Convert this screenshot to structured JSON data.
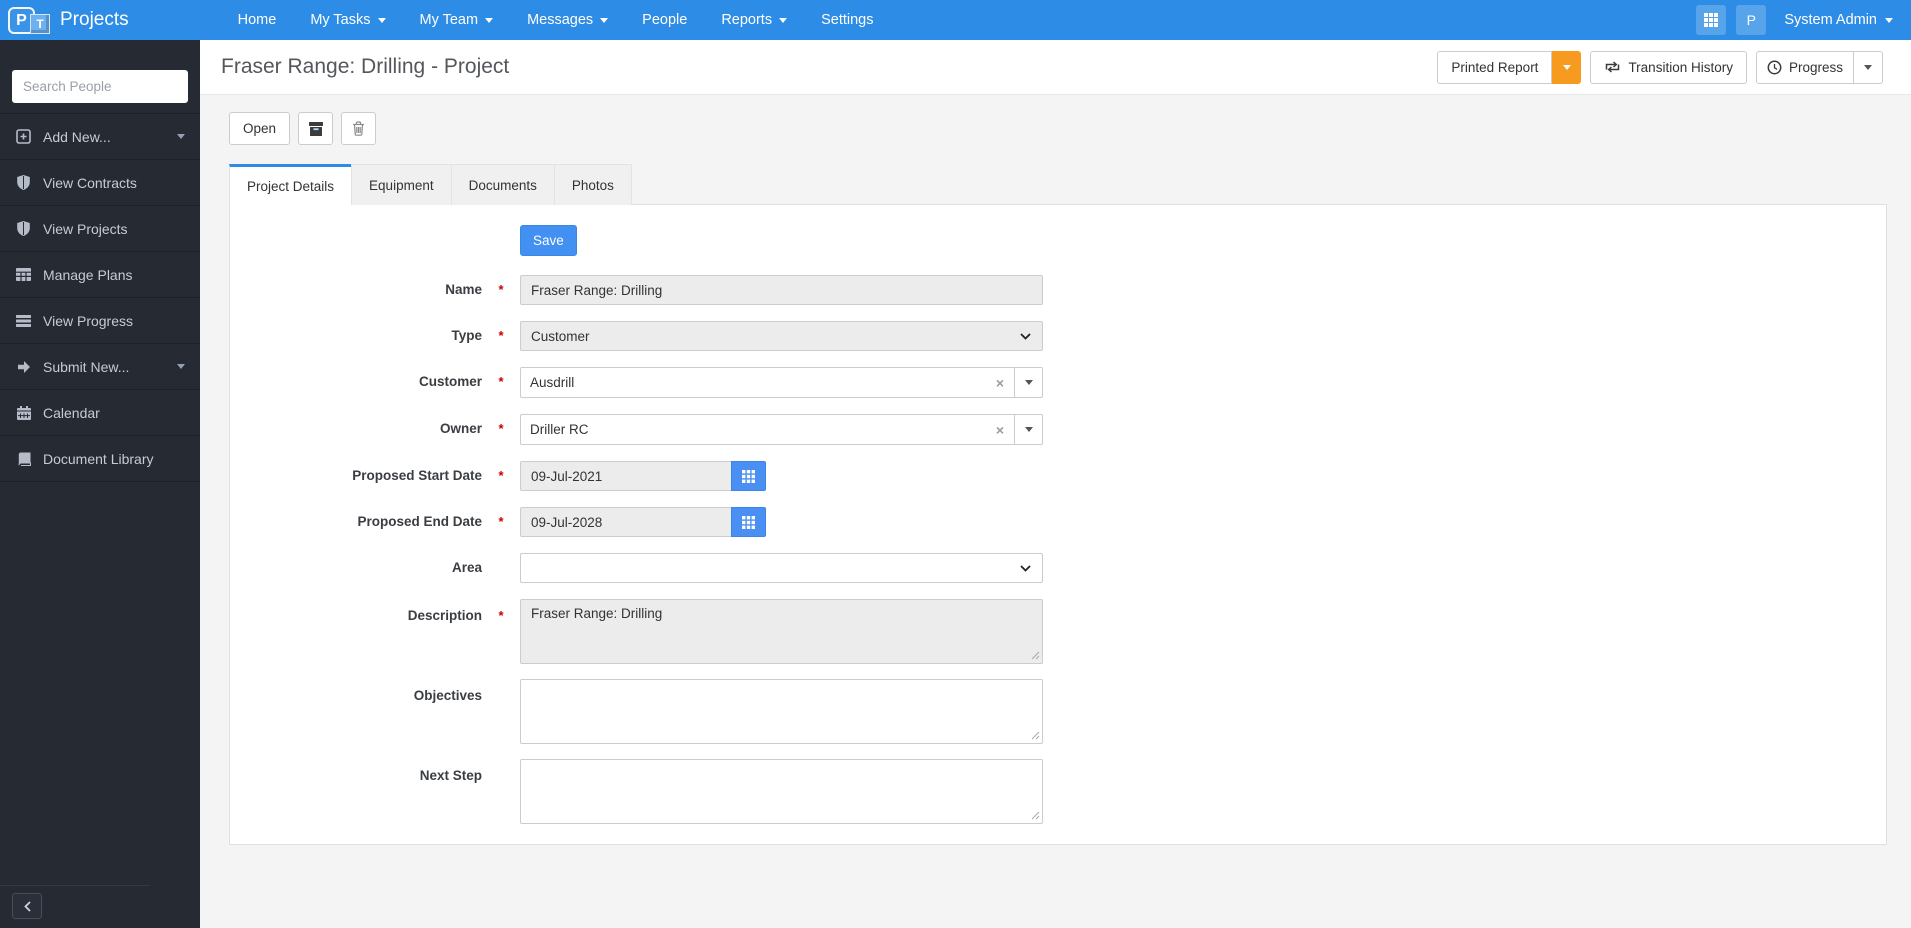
{
  "navbar": {
    "brand": "Projects",
    "logo": {
      "letter_p": "P",
      "letter_t": "T"
    },
    "items": [
      {
        "label": "Home",
        "caret": false
      },
      {
        "label": "My Tasks",
        "caret": true
      },
      {
        "label": "My Team",
        "caret": true
      },
      {
        "label": "Messages",
        "caret": true
      },
      {
        "label": "People",
        "caret": false
      },
      {
        "label": "Reports",
        "caret": true
      },
      {
        "label": "Settings",
        "caret": false
      }
    ],
    "right": {
      "apps_icon": "grid-icon",
      "profile_initial": "P",
      "user": "System Admin"
    }
  },
  "sidebar": {
    "search_placeholder": "Search People",
    "items": [
      {
        "label": "Add New...",
        "icon": "plus-square-icon",
        "caret": true
      },
      {
        "label": "View Contracts",
        "icon": "shield-icon",
        "caret": false
      },
      {
        "label": "View Projects",
        "icon": "shield-icon",
        "caret": false
      },
      {
        "label": "Manage Plans",
        "icon": "table-icon",
        "caret": false
      },
      {
        "label": "View Progress",
        "icon": "progress-bars-icon",
        "caret": false
      },
      {
        "label": "Submit New...",
        "icon": "arrow-right-icon",
        "caret": true
      },
      {
        "label": "Calendar",
        "icon": "calendar-icon",
        "caret": false
      },
      {
        "label": "Document Library",
        "icon": "book-icon",
        "caret": false
      }
    ],
    "collapse_icon": "chevron-left-icon"
  },
  "header": {
    "title": "Fraser Range: Drilling - Project",
    "printed_report_label": "Printed Report",
    "transition_history_label": "Transition History",
    "transition_history_icon": "retweet-icon",
    "progress_label": "Progress",
    "progress_icon": "clock-icon"
  },
  "toolbar": {
    "open_label": "Open",
    "archive_icon": "archive-icon",
    "delete_icon": "trash-icon"
  },
  "tabs": [
    {
      "label": "Project Details",
      "active": true
    },
    {
      "label": "Equipment",
      "active": false
    },
    {
      "label": "Documents",
      "active": false
    },
    {
      "label": "Photos",
      "active": false
    }
  ],
  "form": {
    "save_label": "Save",
    "required_marker": "*",
    "fields": {
      "name": {
        "label": "Name",
        "required": true,
        "value": "Fraser Range: Drilling"
      },
      "type": {
        "label": "Type",
        "required": true,
        "value": "Customer"
      },
      "customer": {
        "label": "Customer",
        "required": true,
        "value": "Ausdrill"
      },
      "owner": {
        "label": "Owner",
        "required": true,
        "value": "Driller RC"
      },
      "proposed_start_date": {
        "label": "Proposed Start Date",
        "required": true,
        "value": "09-Jul-2021"
      },
      "proposed_end_date": {
        "label": "Proposed End Date",
        "required": true,
        "value": "09-Jul-2028"
      },
      "area": {
        "label": "Area",
        "required": false,
        "value": ""
      },
      "description": {
        "label": "Description",
        "required": true,
        "value": "Fraser Range: Drilling"
      },
      "objectives": {
        "label": "Objectives",
        "required": false,
        "value": ""
      },
      "next_step": {
        "label": "Next Step",
        "required": false,
        "value": ""
      }
    }
  },
  "colors": {
    "navbar_blue": "#2d8ce6",
    "accent_blue": "#4190f2",
    "orange": "#f79a20",
    "sidebar_dark": "#262a33",
    "required_red": "#cc0000",
    "page_bg": "#f4f4f4"
  }
}
